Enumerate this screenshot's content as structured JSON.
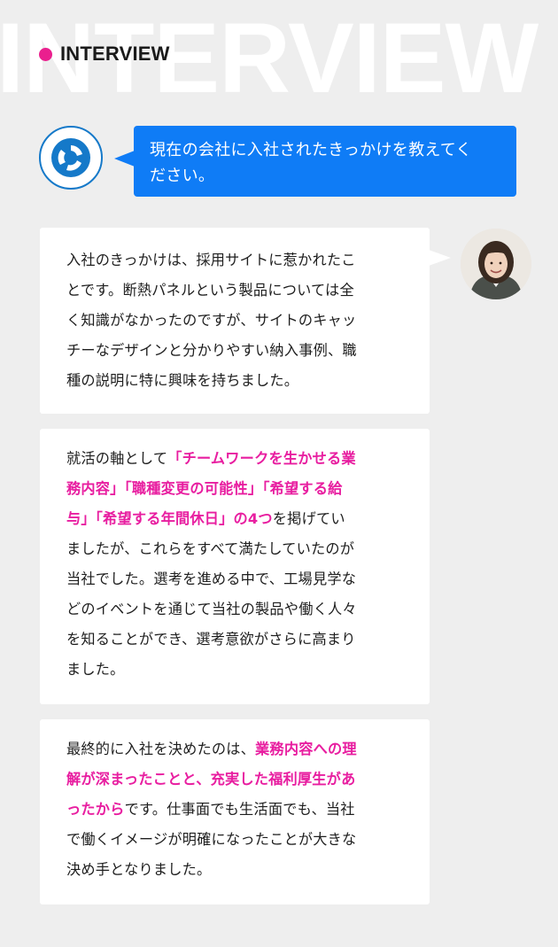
{
  "section": {
    "watermark": "INTERVIEW",
    "title": "INTERVIEW",
    "accent_color": "#ea1f8e"
  },
  "question": {
    "icon": "company-logo-icon",
    "lines": [
      "現在の会社に入社されたきっかけを教えてく",
      "ださい。"
    ],
    "bubble_color": "#0f7cf6"
  },
  "person": {
    "icon": "interviewee-photo"
  },
  "answers": [
    {
      "lines": [
        [
          {
            "t": "入社のきっかけは、採用サイトに惹かれたこ"
          }
        ],
        [
          {
            "t": "とです。断熱パネルという製品については全"
          }
        ],
        [
          {
            "t": "く知識がなかったのですが、サイトのキャッ"
          }
        ],
        [
          {
            "t": "チーなデザインと分かりやすい納入事例、職"
          }
        ],
        [
          {
            "t": "種の説明に特に興味を持ちました。"
          }
        ]
      ]
    },
    {
      "lines": [
        [
          {
            "t": "就活の軸として"
          },
          {
            "t": "「チームワークを生かせる業",
            "hl": true
          }
        ],
        [
          {
            "t": "務内容」「職種変更の可能性」「希望する給",
            "hl": true
          }
        ],
        [
          {
            "t": "与」「希望する年間休日」の4つ",
            "hl": true
          },
          {
            "t": "を掲げてい"
          }
        ],
        [
          {
            "t": "ましたが、これらをすべて満たしていたのが"
          }
        ],
        [
          {
            "t": "当社でした。選考を進める中で、工場見学な"
          }
        ],
        [
          {
            "t": "どのイベントを通じて当社の製品や働く人々"
          }
        ],
        [
          {
            "t": "を知ることができ、選考意欲がさらに高まり"
          }
        ],
        [
          {
            "t": "ました。"
          }
        ]
      ]
    },
    {
      "lines": [
        [
          {
            "t": "最終的に入社を決めたのは、"
          },
          {
            "t": "業務内容への理",
            "hl": true
          }
        ],
        [
          {
            "t": "解が深まったことと、充実した福利厚生があ",
            "hl": true
          }
        ],
        [
          {
            "t": "ったから",
            "hl": true
          },
          {
            "t": "です。仕事面でも生活面でも、当社"
          }
        ],
        [
          {
            "t": "で働くイメージが明確になったことが大きな"
          }
        ],
        [
          {
            "t": "決め手となりました。"
          }
        ]
      ]
    }
  ],
  "highlight_color": "#e81ea0"
}
